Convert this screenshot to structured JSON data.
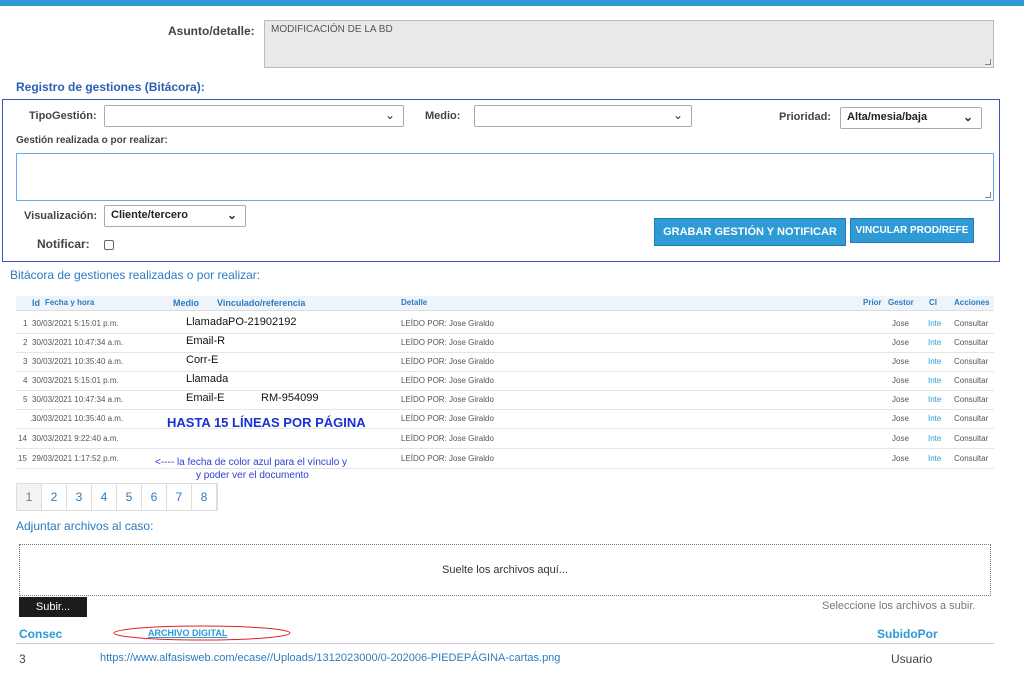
{
  "case": {
    "subject_label": "Asunto/detalle:",
    "subject_value": "MODIFICACIÓN DE LA BD"
  },
  "registro": {
    "title": "Registro de gestiones (Bitácora):",
    "tipo_label": "TipoGestión:",
    "tipo_value": "",
    "medio_label": "Medio:",
    "medio_value": "",
    "prioridad_label": "Prioridad:",
    "prioridad_value": "Alta/mesia/baja",
    "gestion_label": "Gestión realizada o por realizar:",
    "gestion_value": "",
    "visualizacion_label": "Visualización:",
    "visualizacion_value": "Cliente/tercero",
    "notificar_label": "Notificar:",
    "btn_grabar": "GRABAR GESTIÓN Y NOTIFICAR",
    "btn_vincular": "VINCULAR PROD/REFE"
  },
  "bitacora": {
    "title": "Bitácora de gestiones realizadas o por realizar:",
    "headers": {
      "id": "Id",
      "fecha": "Fecha y hora",
      "medio": "Medio",
      "vinculado": "Vinculado/referencia",
      "detalle": "Detalle",
      "prior": "Prior",
      "gestor": "Gestor",
      "ci": "CI",
      "acciones": "Acciones"
    },
    "rows": [
      {
        "id": "1",
        "fecha": "30/03/2021 5:15:01 p.m.",
        "medio": "Llamada",
        "vinculado": "PO-21902192",
        "detalle": "LEÍDO POR: Jose Giraldo",
        "gestor": "Jose",
        "ci": "Inte",
        "accion": "Consultar"
      },
      {
        "id": "2",
        "fecha": "30/03/2021 10:47:34 a.m.",
        "medio": "Email-R",
        "vinculado": "",
        "detalle": "LEÍDO POR: Jose Giraldo",
        "gestor": "Jose",
        "ci": "Inte",
        "accion": "Consultar"
      },
      {
        "id": "3",
        "fecha": "30/03/2021 10:35:40 a.m.",
        "medio": "Corr-E",
        "vinculado": "",
        "detalle": "LEÍDO POR: Jose Giraldo",
        "gestor": "Jose",
        "ci": "Inte",
        "accion": "Consultar"
      },
      {
        "id": "4",
        "fecha": "30/03/2021 5:15:01 p.m.",
        "medio": "Llamada",
        "vinculado": "",
        "detalle": "LEÍDO POR: Jose Giraldo",
        "gestor": "Jose",
        "ci": "Inte",
        "accion": "Consultar"
      },
      {
        "id": "5",
        "fecha": "30/03/2021 10:47:34 a.m.",
        "medio": "Email-E",
        "vinculado": "RM-954099",
        "detalle": "LEÍDO POR: Jose Giraldo",
        "gestor": "Jose",
        "ci": "Inte",
        "accion": "Consultar"
      },
      {
        "id": "...",
        "fecha": "30/03/2021 10:35:40 a.m.",
        "medio": "",
        "vinculado": "",
        "detalle": "LEÍDO POR: Jose Giraldo",
        "gestor": "Jose",
        "ci": "Inte",
        "accion": "Consultar"
      },
      {
        "id": "14",
        "fecha": "30/03/2021 9:22:40 a.m.",
        "medio": "",
        "vinculado": "",
        "detalle": "LEÍDO POR: Jose Giraldo",
        "gestor": "Jose",
        "ci": "Inte",
        "accion": "Consultar"
      },
      {
        "id": "15",
        "fecha": "29/03/2021 1:17:52 p.m.",
        "medio": "",
        "vinculado": "",
        "detalle": "LEÍDO POR: Jose Giraldo",
        "gestor": "Jose",
        "ci": "Inte",
        "accion": "Consultar"
      }
    ],
    "banner": "HASTA 15 LÍNEAS POR PÁGINA",
    "note_line1": "<---- la fecha de color azul para el vínculo y",
    "note_line2": "y poder ver el documento",
    "pages": [
      "1",
      "2",
      "3",
      "4",
      "5",
      "6",
      "7",
      "8"
    ]
  },
  "adjuntar": {
    "title": "Adjuntar archivos al caso:",
    "drop_text": "Suelte los archivos aquí...",
    "btn_subir": "Subir...",
    "hint": "Seleccione los archivos a subir."
  },
  "archivos": {
    "col_consec": "Consec",
    "col_archivo": "ARCHIVO DIGITAL",
    "col_subido": "SubidoPor",
    "rows": [
      {
        "consec": "3",
        "url": "https://www.alfasisweb.com/ecase//Uploads/1312023000/0-202006-PIEDEPÁGINA-cartas.png",
        "subido": "Usuario"
      }
    ]
  },
  "colors": {
    "accent": "#2e9ad6",
    "link": "#2b7cc0",
    "note": "#1a2fd6",
    "box_border": "#3d4fc9"
  }
}
